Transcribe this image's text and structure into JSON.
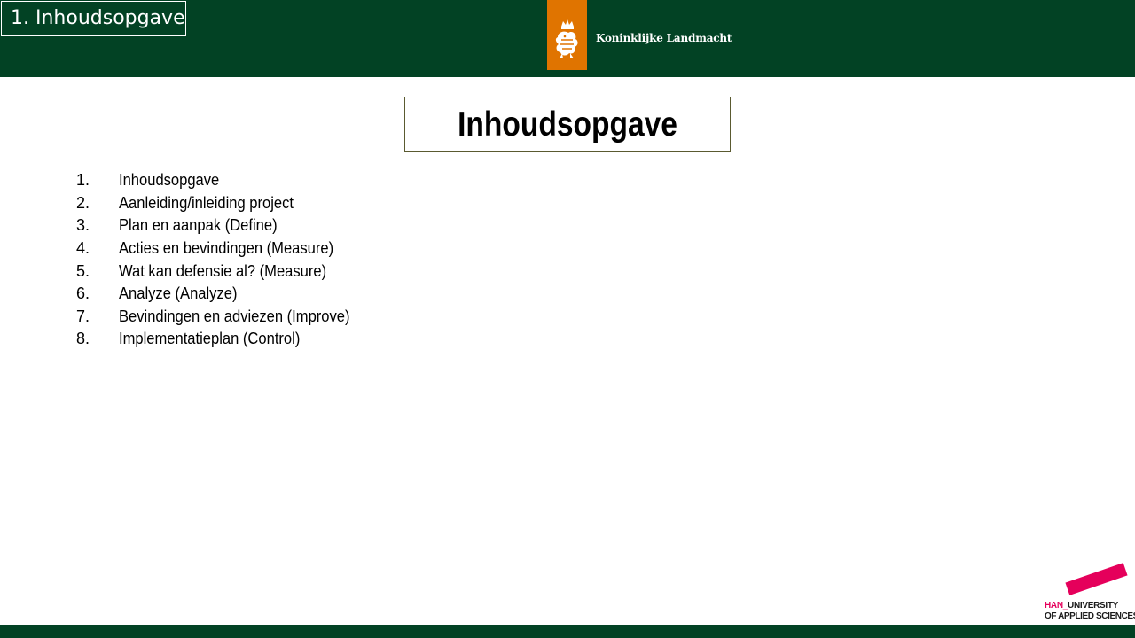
{
  "header": {
    "section_tag": "1. Inhoudsopgave",
    "organization": "Koninklijke Landmacht",
    "emblem_icon": "lion-crest-icon",
    "bar_color": "#024224",
    "emblem_color": "#e07400"
  },
  "main": {
    "title": "Inhoudsopgave",
    "toc": [
      {
        "number": "1.",
        "label": "Inhoudsopgave"
      },
      {
        "number": "2.",
        "label": "Aanleiding/inleiding project"
      },
      {
        "number": "3.",
        "label": "Plan en aanpak (Define)"
      },
      {
        "number": "4.",
        "label": "Acties en bevindingen (Measure)"
      },
      {
        "number": "5.",
        "label": "Wat kan defensie al? (Measure)"
      },
      {
        "number": "6.",
        "label": "Analyze (Analyze)"
      },
      {
        "number": "7.",
        "label": "Bevindingen en adviezen (Improve)"
      },
      {
        "number": "8.",
        "label": "Implementatieplan (Control)"
      }
    ]
  },
  "footer": {
    "logo_prefix": "HAN_",
    "logo_line1": "UNIVERSITY",
    "logo_line2": "OF APPLIED SCIENCES",
    "logo_accent_color": "#e5005b"
  }
}
